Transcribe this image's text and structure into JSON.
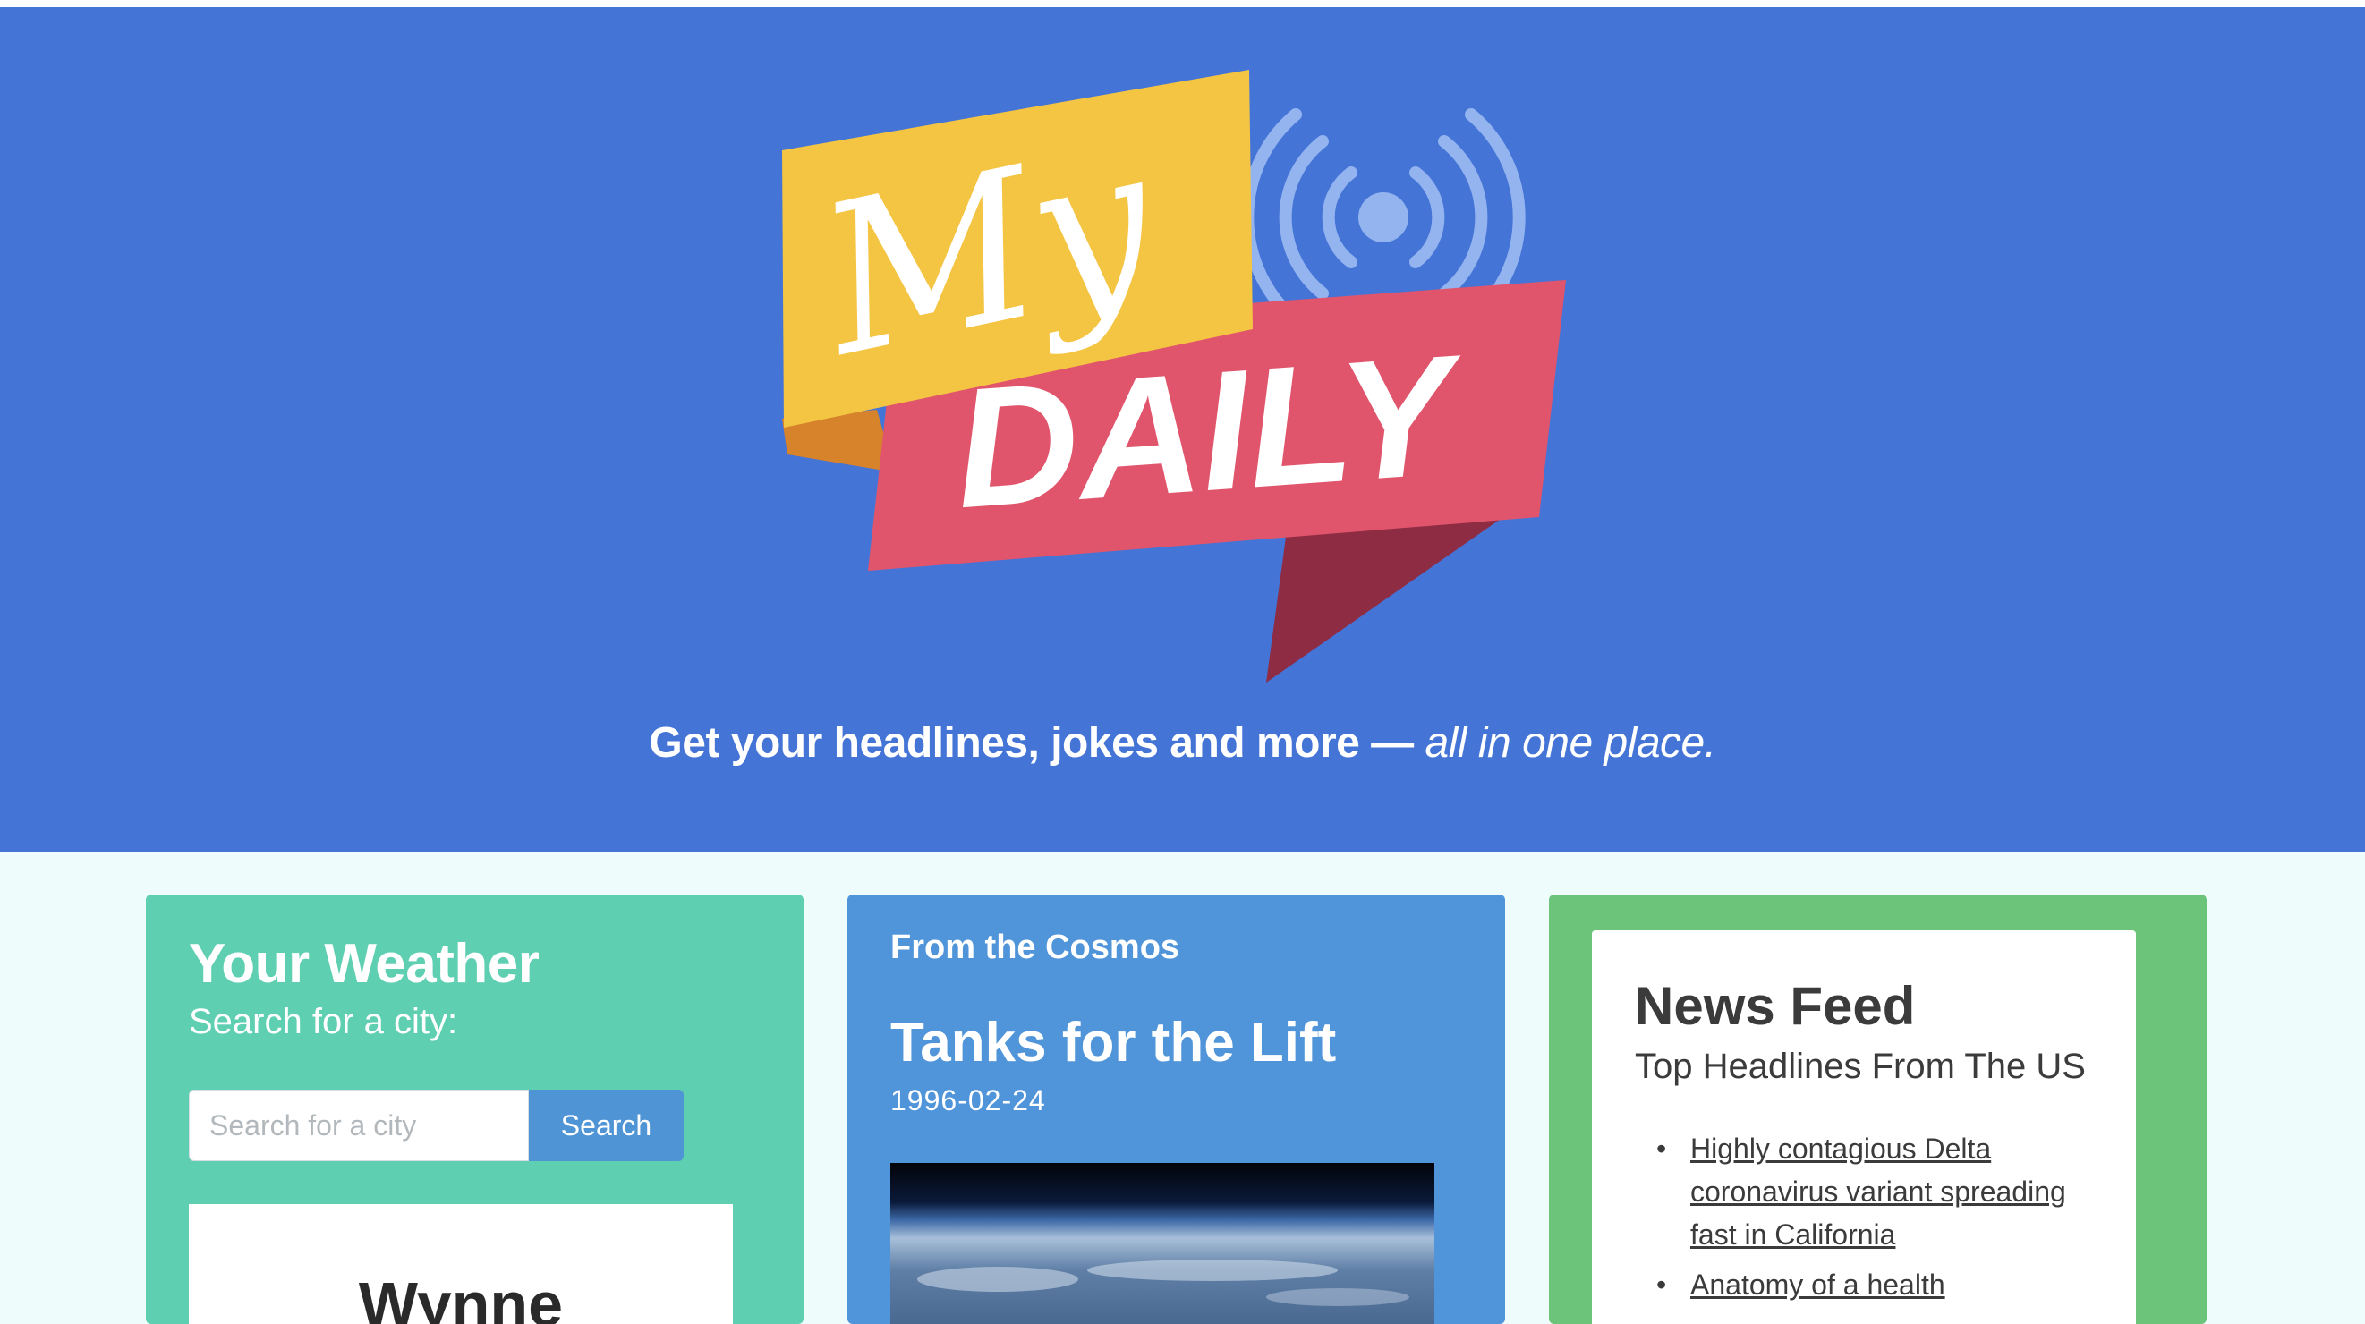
{
  "hero": {
    "logo_text_my": "My",
    "logo_text_daily": "DAILY",
    "tagline_main": "Get your headlines, jokes and more — ",
    "tagline_emphasis": "all in one place.",
    "colors": {
      "background": "#4474d6",
      "yellow": "#f4c443",
      "red": "#e1556c"
    }
  },
  "weather": {
    "title": "Your Weather",
    "subtitle": "Search for a city:",
    "search_placeholder": "Search for a city",
    "search_button": "Search",
    "city": "Wynne"
  },
  "cosmos": {
    "label": "From the Cosmos",
    "title": "Tanks for the Lift",
    "date": "1996-02-24"
  },
  "news": {
    "title": "News Feed",
    "subtitle": "Top Headlines From The US",
    "items": [
      {
        "label": "Highly contagious Delta coronavirus variant spreading fast in California"
      },
      {
        "label": "Anatomy of a health"
      }
    ]
  }
}
